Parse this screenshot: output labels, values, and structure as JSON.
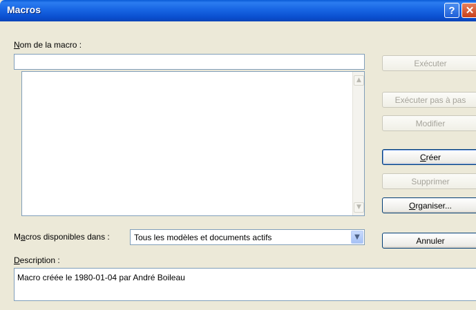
{
  "window": {
    "title": "Macros",
    "help_glyph": "?",
    "close_glyph": "✕"
  },
  "macro_name": {
    "label_accel": "N",
    "label_rest": "om de la macro :",
    "value": ""
  },
  "macro_list": {
    "items": []
  },
  "macros_in": {
    "label_pre": "M",
    "label_accel": "a",
    "label_rest": "cros disponibles dans :",
    "selected": "Tous les modèles et documents actifs"
  },
  "description": {
    "label_accel": "D",
    "label_rest": "escription :",
    "text": "Macro créée le 1980-01-04 par André Boileau"
  },
  "buttons": {
    "run": "Exécuter",
    "step_into": "Exécuter pas à pas",
    "edit": "Modifier",
    "create_accel": "C",
    "create_rest": "réer",
    "delete": "Supprimer",
    "organizer_accel": "O",
    "organizer_rest": "rganiser...",
    "cancel": "Annuler"
  },
  "icons": {
    "scroll_up": "scroll-up-arrow-icon",
    "scroll_down": "scroll-down-arrow-icon",
    "dropdown": "chevron-down-icon"
  },
  "colors": {
    "titlebar": "#0a5bd6",
    "dialog_bg": "#ece9d8",
    "input_border": "#7f9db9",
    "button_border": "#003c74"
  }
}
